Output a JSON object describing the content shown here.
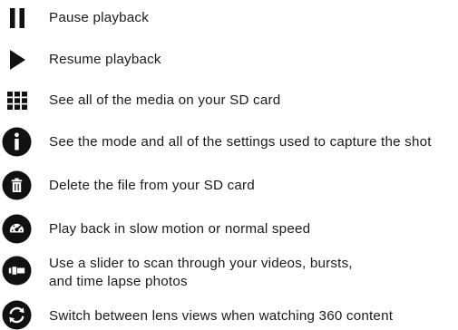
{
  "legend": {
    "items": [
      {
        "icon": "pause-icon",
        "text": "Pause playback"
      },
      {
        "icon": "play-icon",
        "text": "Resume playback"
      },
      {
        "icon": "grid-icon",
        "text": "See all of the media on your SD card"
      },
      {
        "icon": "info-icon",
        "text": "See the mode and all of the settings used to capture the shot"
      },
      {
        "icon": "trash-icon",
        "text": "Delete the file from your SD card"
      },
      {
        "icon": "speed-icon",
        "text": "Play back in slow motion or normal speed"
      },
      {
        "icon": "scrubber-icon",
        "lines": [
          "Use a slider to scan through your videos, bursts,",
          "and time lapse photos"
        ]
      },
      {
        "icon": "lens-switch-icon",
        "text": "Switch between lens views when watching 360 content"
      }
    ]
  },
  "colors": {
    "icon": "#111111",
    "icon_inner": "#ffffff",
    "text": "#1a1a1a"
  }
}
